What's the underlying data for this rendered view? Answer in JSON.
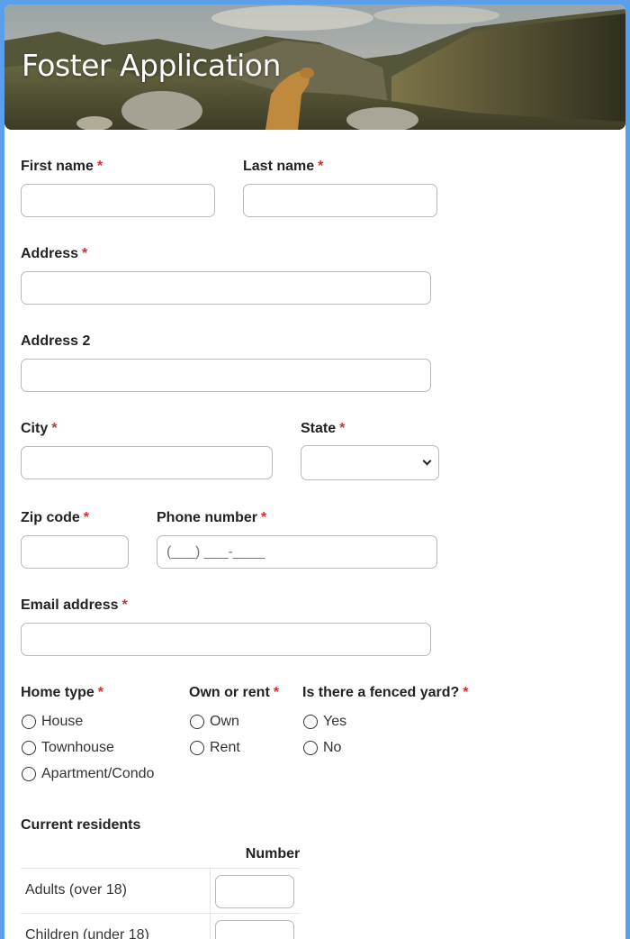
{
  "form": {
    "title": "Foster Application"
  },
  "fields": {
    "first_name": {
      "label": "First name",
      "required_mark": "*",
      "value": ""
    },
    "last_name": {
      "label": "Last name",
      "required_mark": "*",
      "value": ""
    },
    "address": {
      "label": "Address",
      "required_mark": "*",
      "value": ""
    },
    "address2": {
      "label": "Address 2",
      "value": ""
    },
    "city": {
      "label": "City",
      "required_mark": "*",
      "value": ""
    },
    "state": {
      "label": "State",
      "required_mark": "*",
      "selected": ""
    },
    "zip": {
      "label": "Zip code",
      "required_mark": "*",
      "value": ""
    },
    "phone": {
      "label": "Phone number",
      "required_mark": "*",
      "placeholder": "(___) ___-____"
    },
    "email": {
      "label": "Email address",
      "required_mark": "*",
      "value": ""
    }
  },
  "home_type": {
    "label": "Home type",
    "required_mark": "*",
    "options": [
      "House",
      "Townhouse",
      "Apartment/Condo"
    ]
  },
  "own_rent": {
    "label": "Own or rent",
    "required_mark": "*",
    "options": [
      "Own",
      "Rent"
    ]
  },
  "fenced_yard": {
    "label": "Is there a fenced yard?",
    "required_mark": "*",
    "options": [
      "Yes",
      "No"
    ]
  },
  "residents": {
    "label": "Current residents",
    "column_header": "Number",
    "rows": [
      {
        "label": "Adults (over 18)",
        "value": ""
      },
      {
        "label": "Children (under 18)",
        "value": ""
      }
    ]
  },
  "colors": {
    "page_border": "#5b9ee9",
    "required": "#d32f2f"
  }
}
